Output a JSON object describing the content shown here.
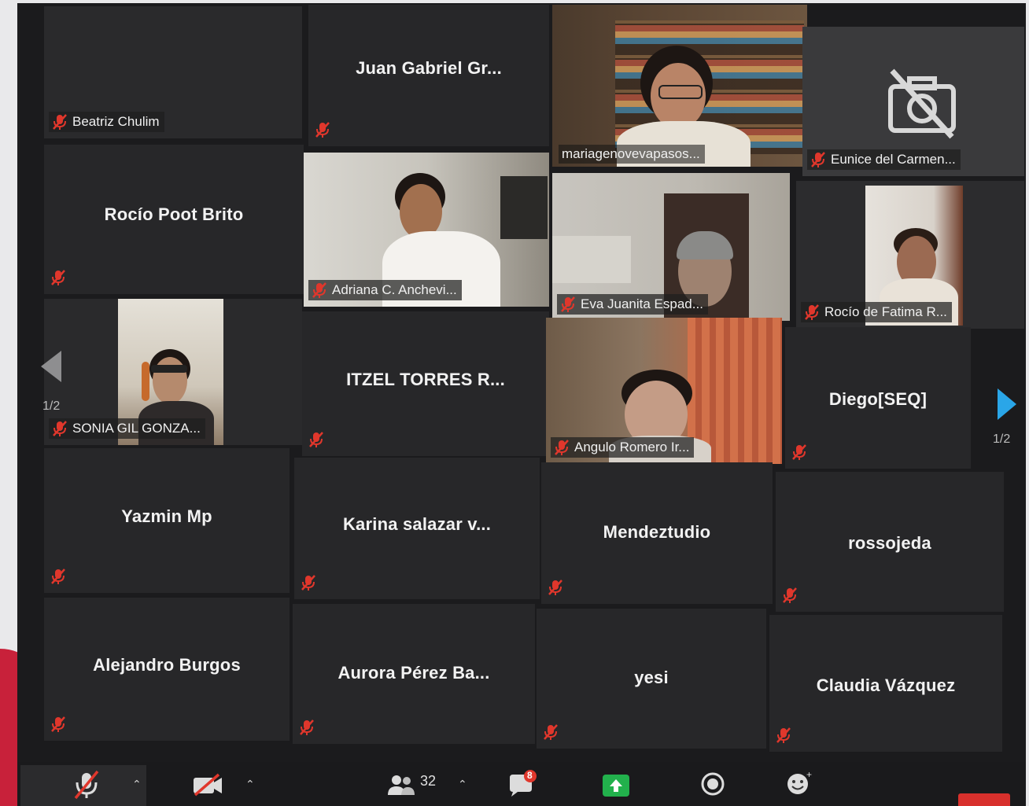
{
  "pagination": {
    "left": "1/2",
    "right": "1/2"
  },
  "tiles": {
    "beatriz": "Beatriz Chulim",
    "juan": "Juan Gabriel Gr...",
    "maria": "mariagenovevapasos...",
    "eunice": "Eunice del Carmen...",
    "rocio_poot": "Rocío Poot Brito",
    "adriana": "Adriana C. Anchevi...",
    "eva": "Eva Juanita Espad...",
    "rocio_fatima": "Rocío de Fatima R...",
    "sonia": "SONIA GIL GONZA...",
    "itzel": "ITZEL TORRES R...",
    "angulo": "Angulo Romero Ir...",
    "diego": "Diego[SEQ]",
    "yazmin": "Yazmin Mp",
    "karina": "Karina salazar v...",
    "mendez": "Mendeztudio",
    "rosso": "rossojeda",
    "alejandro": "Alejandro Burgos",
    "aurora": "Aurora Pérez Ba...",
    "yesi": "yesi",
    "claudia": "Claudia Vázquez"
  },
  "toolbar": {
    "participants_count": "32",
    "chat_badge": "8"
  },
  "colors": {
    "active_speaker_border": "#d5de3a",
    "muted_icon": "#e0372c",
    "next_arrow": "#2aa6e8",
    "share_button": "#22b14c"
  },
  "icons": [
    "mic-muted-icon",
    "camera-off-icon",
    "participants-icon",
    "chat-icon",
    "share-screen-icon",
    "record-icon",
    "reactions-icon",
    "prev-page-icon",
    "next-page-icon"
  ]
}
